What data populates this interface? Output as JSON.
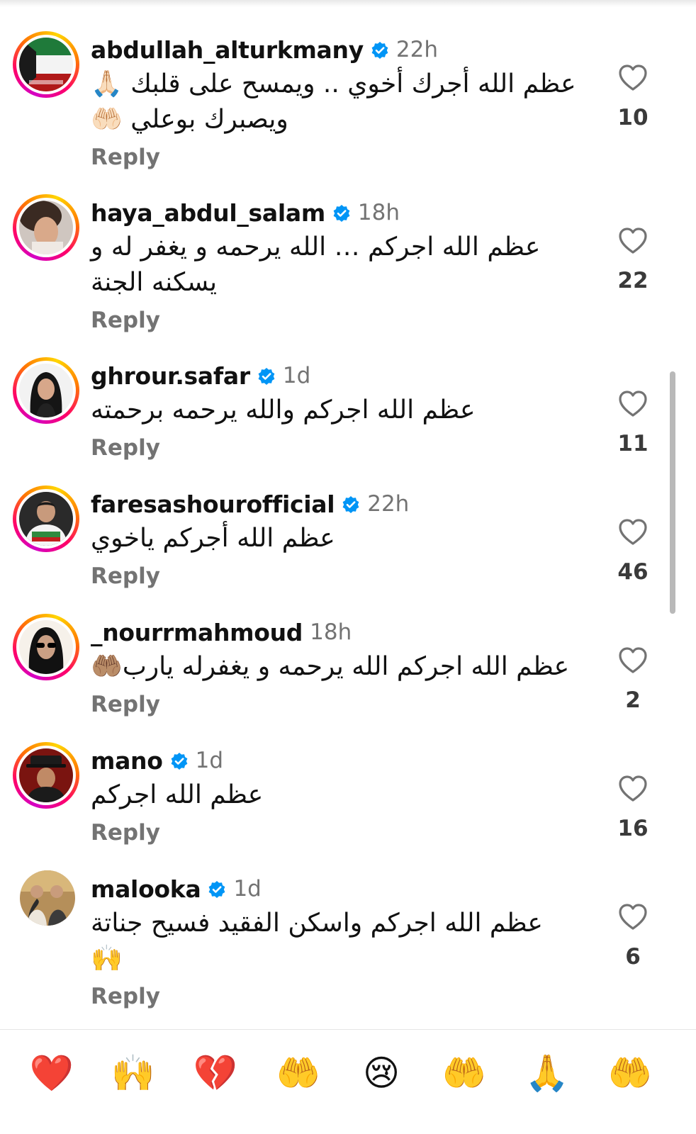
{
  "comments": [
    {
      "username": "abdullah_alturkmany",
      "verified": true,
      "time": "22h",
      "text": "عظم الله أجرك أخوي .. ويمسح على قلبك 🙏🏻\nويصبرك بوعلي 🤲🏻",
      "reply_label": "Reply",
      "likes": "10",
      "avatar_icon": "kuwait-flag-avatar",
      "story_ring": true
    },
    {
      "username": "haya_abdul_salam",
      "verified": true,
      "time": "18h",
      "text": "عظم الله اجركم … الله يرحمه و يغفر له و\nيسكنه الجنة",
      "reply_label": "Reply",
      "likes": "22",
      "avatar_icon": "woman-portrait-avatar",
      "story_ring": true
    },
    {
      "username": "ghrour.safar",
      "verified": true,
      "time": "1d",
      "text": "عظم الله اجركم والله يرحمه برحمته",
      "reply_label": "Reply",
      "likes": "11",
      "avatar_icon": "woman-portrait-avatar",
      "story_ring": true
    },
    {
      "username": "faresashourofficial",
      "verified": true,
      "time": "22h",
      "text": "عظم الله أجركم ياخوي",
      "reply_label": "Reply",
      "likes": "46",
      "avatar_icon": "man-portrait-avatar",
      "story_ring": true
    },
    {
      "username": "_nourrmahmoud",
      "verified": false,
      "time": "18h",
      "text": "عظم الله اجركم الله يرحمه و يغفرله يارب🤲🏽",
      "reply_label": "Reply",
      "likes": "2",
      "avatar_icon": "woman-sunglasses-avatar",
      "story_ring": true
    },
    {
      "username": "mano",
      "verified": true,
      "time": "1d",
      "text": "عظم الله اجركم",
      "reply_label": "Reply",
      "likes": "16",
      "avatar_icon": "man-hat-avatar",
      "story_ring": true
    },
    {
      "username": "malooka",
      "verified": true,
      "time": "1d",
      "text": "عظم الله اجركم واسكن الفقيد فسيح جناتة\n🙌",
      "reply_label": "Reply",
      "likes": "6",
      "avatar_icon": "group-photo-avatar",
      "story_ring": false
    }
  ],
  "emoji_bar": [
    "❤️",
    "🙌",
    "💔",
    "🤲",
    "😢",
    "🤲",
    "🙏",
    "🤲"
  ],
  "colors": {
    "text": "#111111",
    "secondary": "#737373",
    "verified": "#0095f6",
    "heart_outline": "#737373"
  }
}
